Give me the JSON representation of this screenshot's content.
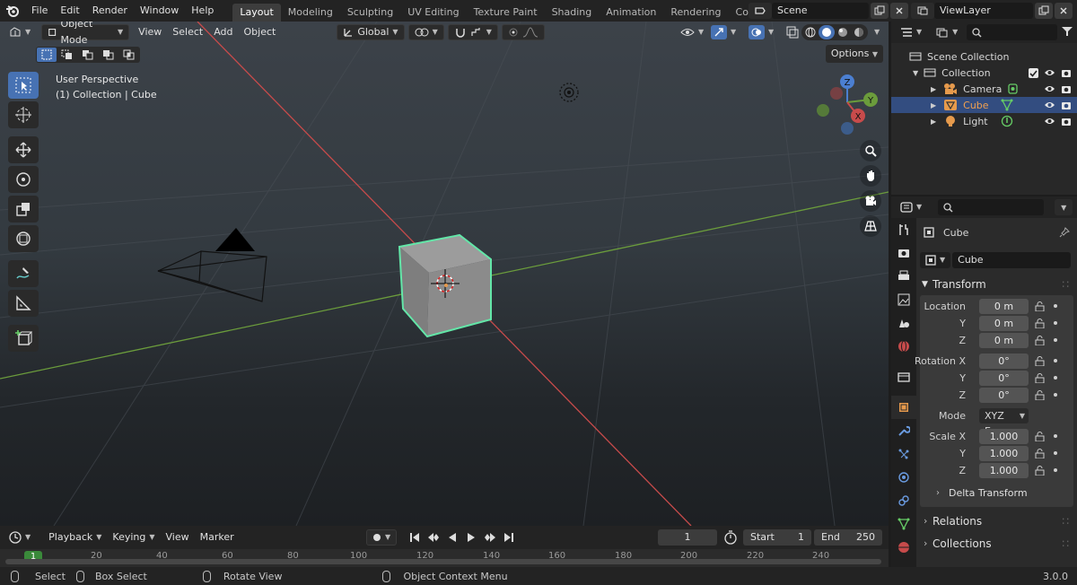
{
  "topbar": {
    "menus": [
      "File",
      "Edit",
      "Render",
      "Window",
      "Help"
    ],
    "workspaces": [
      "Layout",
      "Modeling",
      "Sculpting",
      "UV Editing",
      "Texture Paint",
      "Shading",
      "Animation",
      "Rendering",
      "Compositing"
    ],
    "active_workspace": "Layout",
    "scene": "Scene",
    "view_layer": "ViewLayer"
  },
  "viewport": {
    "mode": "Object Mode",
    "menus": [
      "View",
      "Select",
      "Add",
      "Object"
    ],
    "orientation": "Global",
    "options_label": "Options",
    "overlay_line1": "User Perspective",
    "overlay_line2": "(1) Collection | Cube",
    "gizmo_axes": {
      "x": "X",
      "y": "Y",
      "z": "Z"
    }
  },
  "timeline": {
    "menus": [
      "Playback",
      "Keying",
      "View",
      "Marker"
    ],
    "current_frame": "1",
    "start_label": "Start",
    "start_value": "1",
    "end_label": "End",
    "end_value": "250",
    "ruler_labels": [
      "1",
      "20",
      "40",
      "60",
      "80",
      "100",
      "120",
      "140",
      "160",
      "180",
      "200",
      "220",
      "240"
    ]
  },
  "statusbar": {
    "select": "Select",
    "box_select": "Box Select",
    "rotate_view": "Rotate View",
    "context_menu": "Object Context Menu",
    "version": "3.0.0"
  },
  "outliner": {
    "scene_collection": "Scene Collection",
    "collection": "Collection",
    "items": [
      {
        "name": "Camera",
        "color": "#e69a4c"
      },
      {
        "name": "Cube",
        "color": "#e69a4c"
      },
      {
        "name": "Light",
        "color": "#e69a4c"
      }
    ]
  },
  "properties": {
    "object_name": "Cube",
    "object_field": "Cube",
    "transform_title": "Transform",
    "location_label": "Location",
    "rotation_label": "Rotation X",
    "scale_label": "Scale X",
    "y_label": "Y",
    "z_label": "Z",
    "location": [
      "0 m",
      "0 m",
      "0 m"
    ],
    "rotation": [
      "0°",
      "0°",
      "0°"
    ],
    "mode_label": "Mode",
    "mode_value": "XYZ E...",
    "scale": [
      "1.000",
      "1.000",
      "1.000"
    ],
    "delta_transform": "Delta Transform",
    "relations": "Relations",
    "collections": "Collections"
  },
  "colors": {
    "accent": "#4772b3",
    "selected_outline": "#63e6a8",
    "axis_x": "#c74b4b",
    "axis_y": "#6b9c3c"
  }
}
